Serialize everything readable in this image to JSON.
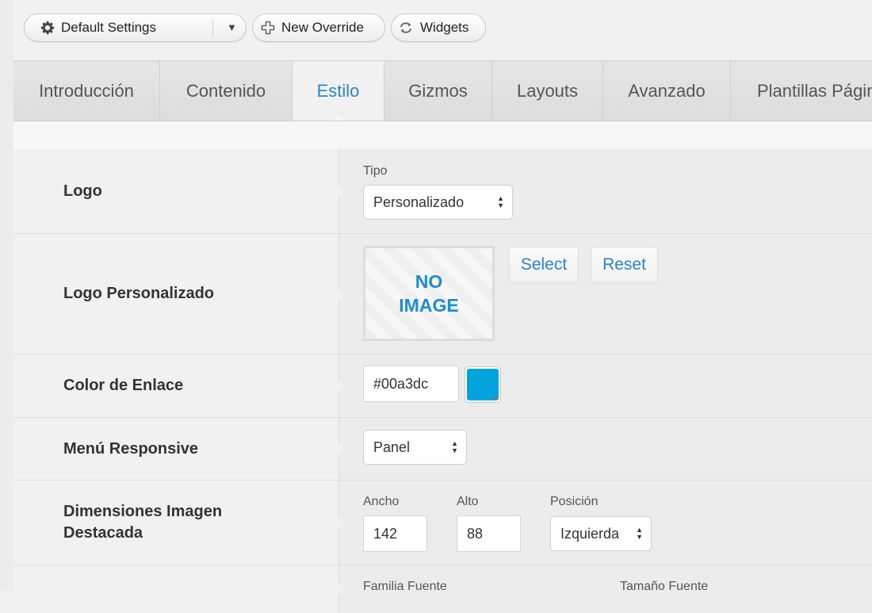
{
  "toolbar": {
    "settings_label": "Default Settings",
    "settings_caret": "▼",
    "new_override_label": "New Override",
    "widgets_label": "Widgets"
  },
  "tabs": [
    {
      "label": "Introducción",
      "active": false
    },
    {
      "label": "Contenido",
      "active": false
    },
    {
      "label": "Estilo",
      "active": true
    },
    {
      "label": "Gizmos",
      "active": false
    },
    {
      "label": "Layouts",
      "active": false
    },
    {
      "label": "Avanzado",
      "active": false
    },
    {
      "label": "Plantillas Págin",
      "active": false
    }
  ],
  "rows": {
    "logo": {
      "label": "Logo",
      "tipo_label": "Tipo",
      "tipo_value": "Personalizado"
    },
    "logo_custom": {
      "label": "Logo Personalizado",
      "no_image_line1": "NO",
      "no_image_line2": "IMAGE",
      "select_label": "Select",
      "reset_label": "Reset"
    },
    "link_color": {
      "label": "Color de Enlace",
      "value": "#00a3dc",
      "swatch_color": "#00a3dc"
    },
    "responsive_menu": {
      "label": "Menú Responsive",
      "value": "Panel"
    },
    "featured_image": {
      "label_line1": "Dimensiones Imagen",
      "label_line2": "Destacada",
      "width_label": "Ancho",
      "width_value": "142",
      "height_label": "Alto",
      "height_value": "88",
      "position_label": "Posición",
      "position_value": "Izquierda"
    },
    "font": {
      "family_label": "Familia Fuente",
      "size_label": "Tamaño Fuente"
    }
  },
  "colors": {
    "accent": "#2a86c2",
    "link_color": "#00a3dc"
  },
  "icons": {
    "settings": "gear-icon",
    "override": "plus-icon",
    "widgets": "refresh-icon"
  }
}
